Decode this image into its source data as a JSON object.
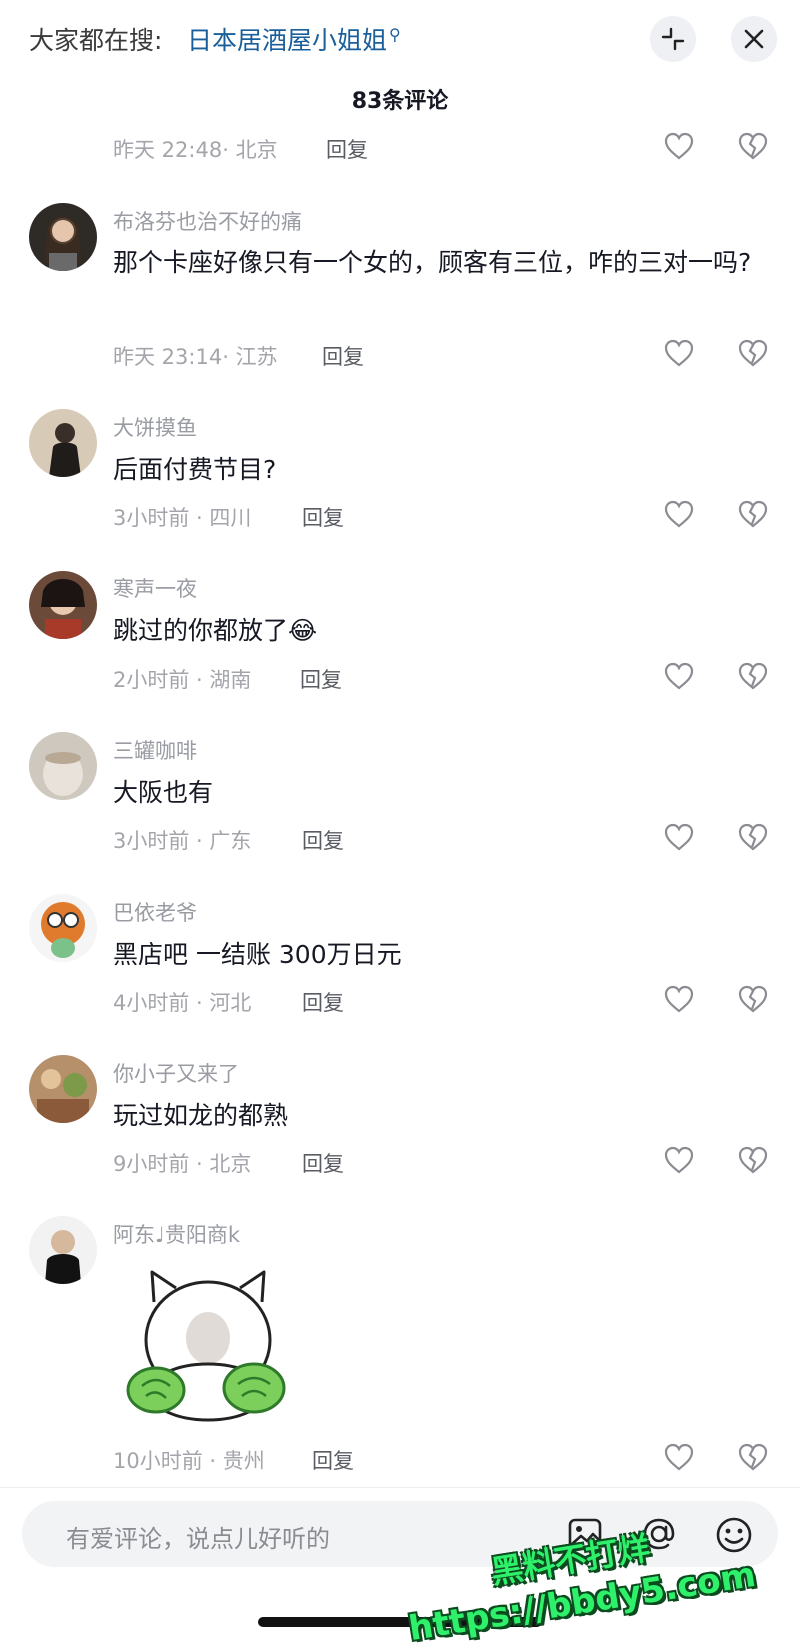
{
  "header": {
    "search_prefix": "大家都在搜:",
    "search_term": "日本居酒屋小姐姐",
    "comment_count_title": "83条评论"
  },
  "comments": [
    {
      "username": "",
      "text": "",
      "time": "昨天 22:48",
      "location": "北京",
      "reply": "回复"
    },
    {
      "username": "布洛芬也治不好的痛",
      "text": "那个卡座好像只有一个女的，顾客有三位，咋的三对一吗?",
      "time": "昨天 23:14",
      "location": "江苏",
      "reply": "回复"
    },
    {
      "username": "大饼摸鱼",
      "text": "后面付费节目?",
      "time": "3小时前",
      "location": "四川",
      "reply": "回复"
    },
    {
      "username": "寒声一夜",
      "text": "跳过的你都放了",
      "emoji": "😂",
      "time": "2小时前",
      "location": "湖南",
      "reply": "回复"
    },
    {
      "username": "三罐咖啡",
      "text": "大阪也有",
      "time": "3小时前",
      "location": "广东",
      "reply": "回复"
    },
    {
      "username": "巴依老爷",
      "text": "黑店吧 一结账 300万日元",
      "time": "4小时前",
      "location": "河北",
      "reply": "回复"
    },
    {
      "username": "你小子又来了",
      "text": "玩过如龙的都熟",
      "time": "9小时前",
      "location": "北京",
      "reply": "回复"
    },
    {
      "username": "阿东♩贵阳商k",
      "text": "",
      "sticker": "cat-holding-cabbage-sticker",
      "time": "10小时前",
      "location": "贵州",
      "reply": "回复"
    }
  ],
  "input": {
    "placeholder": "有爱评论，说点儿好听的"
  },
  "watermark": {
    "line1": "黑料不打烊",
    "line2": "https://bbdy5.com"
  },
  "icons": [
    "collapse-icon",
    "close-icon",
    "heart-icon",
    "dislike-icon",
    "image-icon",
    "mention-icon",
    "emoji-icon"
  ]
}
